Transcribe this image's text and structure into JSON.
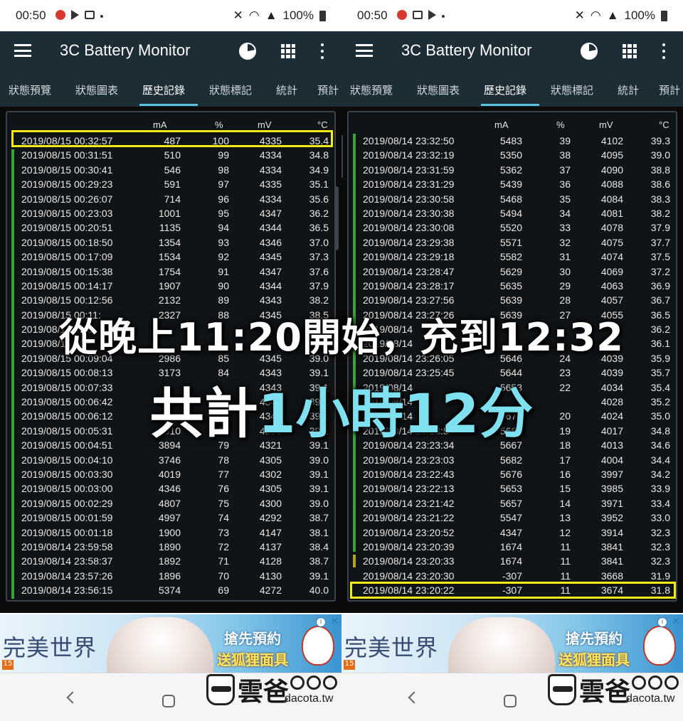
{
  "status": {
    "time": "00:50",
    "battery": "100%"
  },
  "app": {
    "title": "3C Battery Monitor"
  },
  "tabs": [
    "狀態預覽",
    "狀態圖表",
    "歷史記錄",
    "狀態標記",
    "統計",
    "預計"
  ],
  "active_tab": 2,
  "table_headers": {
    "ma": "mA",
    "pct": "%",
    "mv": "mV",
    "temp": "°C"
  },
  "left_rows": [
    [
      "2019/08/15  00:32:57",
      "487",
      "100",
      "4335",
      "35.4"
    ],
    [
      "2019/08/15  00:31:51",
      "510",
      "99",
      "4334",
      "34.8"
    ],
    [
      "2019/08/15  00:30:41",
      "546",
      "98",
      "4334",
      "34.9"
    ],
    [
      "2019/08/15  00:29:23",
      "591",
      "97",
      "4335",
      "35.1"
    ],
    [
      "2019/08/15  00:26:07",
      "714",
      "96",
      "4334",
      "35.6"
    ],
    [
      "2019/08/15  00:23:03",
      "1001",
      "95",
      "4347",
      "36.2"
    ],
    [
      "2019/08/15  00:20:51",
      "1135",
      "94",
      "4344",
      "36.5"
    ],
    [
      "2019/08/15  00:18:50",
      "1354",
      "93",
      "4346",
      "37.0"
    ],
    [
      "2019/08/15  00:17:09",
      "1534",
      "92",
      "4345",
      "37.3"
    ],
    [
      "2019/08/15  00:15:38",
      "1754",
      "91",
      "4347",
      "37.6"
    ],
    [
      "2019/08/15  00:14:17",
      "1907",
      "90",
      "4344",
      "37.9"
    ],
    [
      "2019/08/15  00:12:56",
      "2132",
      "89",
      "4343",
      "38.2"
    ],
    [
      "2019/08/15  00:11:",
      "2327",
      "88",
      "4345",
      "38.5"
    ],
    [
      "2019/08/15  00:1",
      "",
      "",
      "",
      ""
    ],
    [
      "2019/08/15  00:",
      "",
      "",
      "",
      ""
    ],
    [
      "2019/08/15  00:09:04",
      "2986",
      "85",
      "4345",
      "39.0"
    ],
    [
      "2019/08/15  00:08:13",
      "3173",
      "84",
      "4343",
      "39.1"
    ],
    [
      "2019/08/15  00:07:33",
      "",
      "",
      "4343",
      "39.1"
    ],
    [
      "2019/08/15  00:06:42",
      "",
      "",
      "4342",
      "39.1"
    ],
    [
      "2019/08/15  00:06:12",
      "",
      "",
      "4345",
      "39.1"
    ],
    [
      "2019/08/15  00:05:31",
      "3910",
      "80",
      "4335",
      "39.1"
    ],
    [
      "2019/08/15  00:04:51",
      "3894",
      "79",
      "4321",
      "39.1"
    ],
    [
      "2019/08/15  00:04:10",
      "3746",
      "78",
      "4305",
      "39.0"
    ],
    [
      "2019/08/15  00:03:30",
      "4019",
      "77",
      "4302",
      "39.1"
    ],
    [
      "2019/08/15  00:03:00",
      "4346",
      "76",
      "4305",
      "39.1"
    ],
    [
      "2019/08/15  00:02:29",
      "4807",
      "75",
      "4300",
      "39.0"
    ],
    [
      "2019/08/15  00:01:59",
      "4997",
      "74",
      "4292",
      "38.7"
    ],
    [
      "2019/08/15  00:01:18",
      "1900",
      "73",
      "4147",
      "38.1"
    ],
    [
      "2019/08/14  23:59:58",
      "1890",
      "72",
      "4137",
      "38.4"
    ],
    [
      "2019/08/14  23:58:37",
      "1892",
      "71",
      "4128",
      "38.7"
    ],
    [
      "2019/08/14  23:57:26",
      "1896",
      "70",
      "4130",
      "39.1"
    ],
    [
      "2019/08/14  23:56:15",
      "5374",
      "69",
      "4272",
      "40.0"
    ]
  ],
  "right_rows": [
    [
      "2019/08/14  23:32:50",
      "5483",
      "39",
      "4102",
      "39.3"
    ],
    [
      "2019/08/14  23:32:19",
      "5350",
      "38",
      "4095",
      "39.0"
    ],
    [
      "2019/08/14  23:31:59",
      "5362",
      "37",
      "4090",
      "38.8"
    ],
    [
      "2019/08/14  23:31:29",
      "5439",
      "36",
      "4088",
      "38.6"
    ],
    [
      "2019/08/14  23:30:58",
      "5468",
      "35",
      "4084",
      "38.3"
    ],
    [
      "2019/08/14  23:30:38",
      "5494",
      "34",
      "4081",
      "38.2"
    ],
    [
      "2019/08/14  23:30:08",
      "5520",
      "33",
      "4078",
      "37.9"
    ],
    [
      "2019/08/14  23:29:38",
      "5571",
      "32",
      "4075",
      "37.7"
    ],
    [
      "2019/08/14  23:29:18",
      "5582",
      "31",
      "4074",
      "37.5"
    ],
    [
      "2019/08/14  23:28:47",
      "5629",
      "30",
      "4069",
      "37.2"
    ],
    [
      "2019/08/14  23:28:17",
      "5635",
      "29",
      "4063",
      "36.9"
    ],
    [
      "2019/08/14  23:27:56",
      "5639",
      "28",
      "4057",
      "36.7"
    ],
    [
      "2019/08/14  23:27:26",
      "5639",
      "27",
      "4055",
      "36.5"
    ],
    [
      "2019/08/14",
      "",
      "",
      "",
      "36.2"
    ],
    [
      "2019/08/14",
      "",
      "",
      "",
      "36.1"
    ],
    [
      "2019/08/14  23:26:05",
      "5646",
      "24",
      "4039",
      "35.9"
    ],
    [
      "2019/08/14  23:25:45",
      "5644",
      "23",
      "4039",
      "35.7"
    ],
    [
      "2019/08/14",
      "5653",
      "22",
      "4034",
      "35.4"
    ],
    [
      "2019/08/14",
      "",
      "",
      "4028",
      "35.2"
    ],
    [
      "2019/08/14",
      "5671",
      "20",
      "4024",
      "35.0"
    ],
    [
      "2019/08/14  23:23:54",
      "5663",
      "19",
      "4017",
      "34.8"
    ],
    [
      "2019/08/14  23:23:34",
      "5667",
      "18",
      "4013",
      "34.6"
    ],
    [
      "2019/08/14  23:23:03",
      "5682",
      "17",
      "4004",
      "34.4"
    ],
    [
      "2019/08/14  23:22:43",
      "5676",
      "16",
      "3997",
      "34.2"
    ],
    [
      "2019/08/14  23:22:13",
      "5653",
      "15",
      "3985",
      "33.9"
    ],
    [
      "2019/08/14  23:21:42",
      "5657",
      "14",
      "3971",
      "33.4"
    ],
    [
      "2019/08/14  23:21:22",
      "5547",
      "13",
      "3952",
      "33.0"
    ],
    [
      "2019/08/14  23:20:52",
      "4347",
      "12",
      "3914",
      "32.3"
    ],
    [
      "2019/08/14  23:20:39",
      "1674",
      "11",
      "3841",
      "32.3"
    ],
    [
      "2019/08/14  23:20:33",
      "1674",
      "11",
      "3841",
      "32.3"
    ],
    [
      "2019/08/14  23:20:30",
      "-307",
      "11",
      "3668",
      "31.9"
    ],
    [
      "2019/08/14  23:20:22",
      "-307",
      "11",
      "3674",
      "31.8"
    ]
  ],
  "overlay": {
    "line1": "從晚上11:20開始，充到12:32",
    "line2_prefix": "共計",
    "line2_highlight": "1小時12分"
  },
  "ad": {
    "game_title": "完美世界",
    "cta_line1": "搶先預約",
    "cta_line2": "送狐狸面具",
    "age_rating": "15"
  },
  "watermark": {
    "brand": "雲爸",
    "domain": "dacota.tw"
  },
  "colors": {
    "appbar": "#1c2d36",
    "highlight_box": "#f3ea1b",
    "charge_bar": "#3aa33a",
    "overlay_accent": "#7fe0f0"
  }
}
